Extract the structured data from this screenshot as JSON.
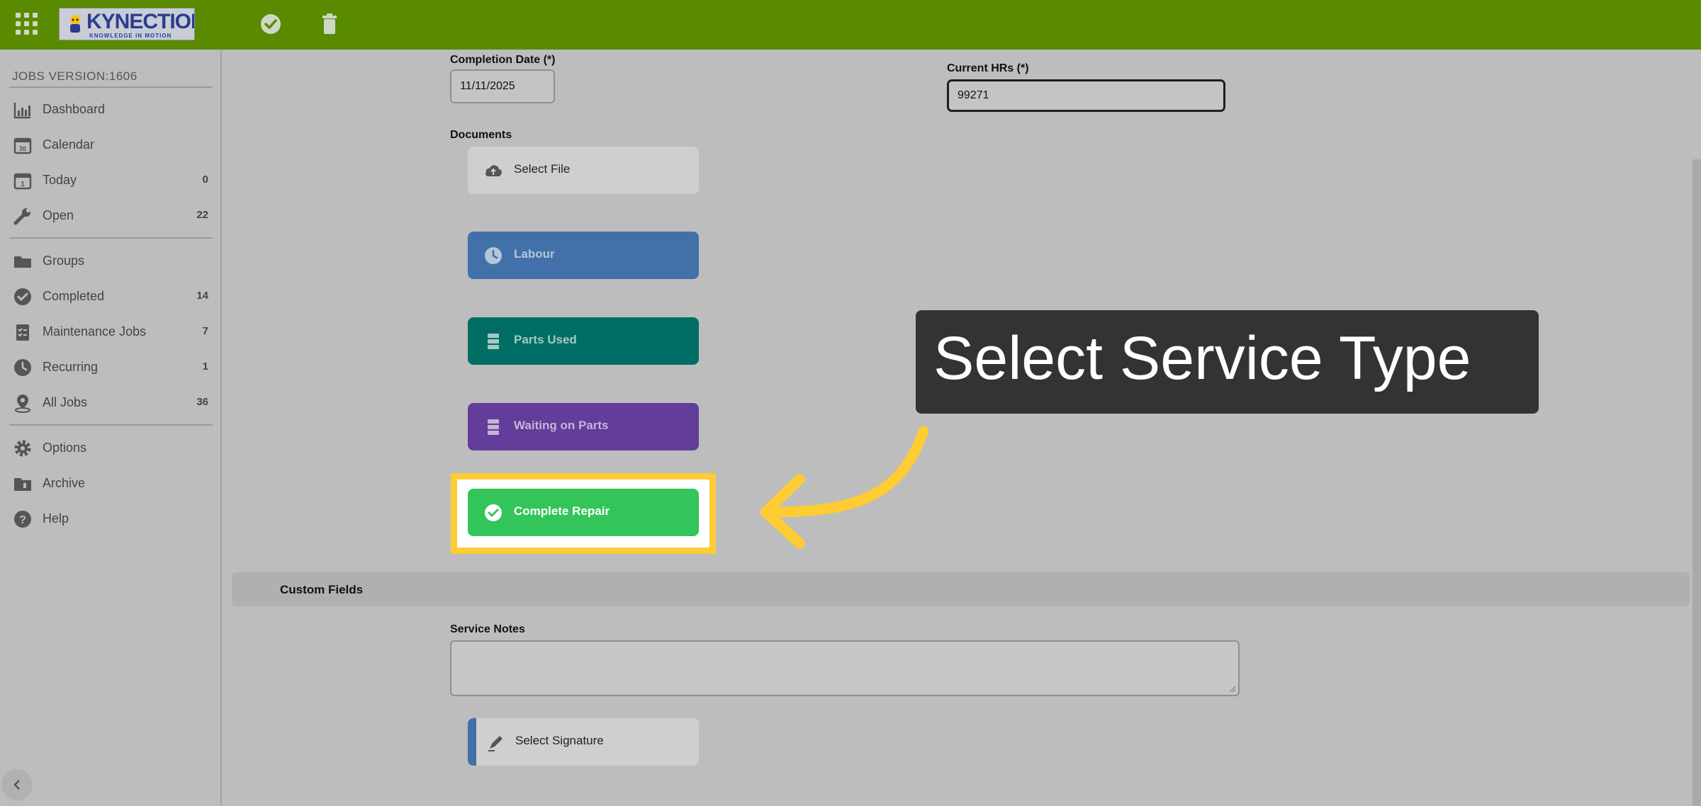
{
  "header": {
    "logo_text": "KYNECTION",
    "logo_tagline": "KNOWLEDGE IN MOTION",
    "icons": [
      "apps-grid-icon",
      "check-circle-icon",
      "trash-icon"
    ]
  },
  "sidebar": {
    "version": "JOBS VERSION:1606",
    "items": [
      {
        "label": "Dashboard",
        "count": "",
        "icon": "chart-icon"
      },
      {
        "label": "Calendar",
        "count": "",
        "icon": "calendar-icon"
      },
      {
        "label": "Today",
        "count": "0",
        "icon": "calendar-today-icon"
      },
      {
        "label": "Open",
        "count": "22",
        "icon": "wrench-icon"
      },
      {
        "label": "Groups",
        "count": "",
        "icon": "folder-icon"
      },
      {
        "label": "Completed",
        "count": "14",
        "icon": "check-circle-icon"
      },
      {
        "label": "Maintenance Jobs",
        "count": "7",
        "icon": "checklist-icon"
      },
      {
        "label": "Recurring",
        "count": "1",
        "icon": "clock-icon"
      },
      {
        "label": "All Jobs",
        "count": "36",
        "icon": "map-pin-icon"
      },
      {
        "label": "Options",
        "count": "",
        "icon": "gear-icon"
      },
      {
        "label": "Archive",
        "count": "",
        "icon": "archive-icon"
      },
      {
        "label": "Help",
        "count": "",
        "icon": "help-icon"
      }
    ]
  },
  "form": {
    "completion_date_label": "Completion Date (*)",
    "completion_date_value": "11/11/2025",
    "current_hrs_label": "Current HRs (*)",
    "current_hrs_value": "99271",
    "documents_label": "Documents",
    "select_file": "Select File",
    "labour": "Labour",
    "parts_used": "Parts Used",
    "waiting_on_parts": "Waiting on Parts",
    "complete_repair": "Complete Repair",
    "custom_fields": "Custom Fields",
    "service_notes_label": "Service Notes",
    "service_notes_value": "",
    "select_signature": "Select Signature"
  },
  "callout": {
    "text": "Select Service Type"
  },
  "colors": {
    "topbar": "#5a8a00",
    "labour": "#4270a8",
    "parts_used": "#006e64",
    "waiting_on_parts": "#623d99",
    "complete_repair": "#33c45a",
    "highlight": "#ffcc33",
    "callout_bg": "#333333"
  }
}
